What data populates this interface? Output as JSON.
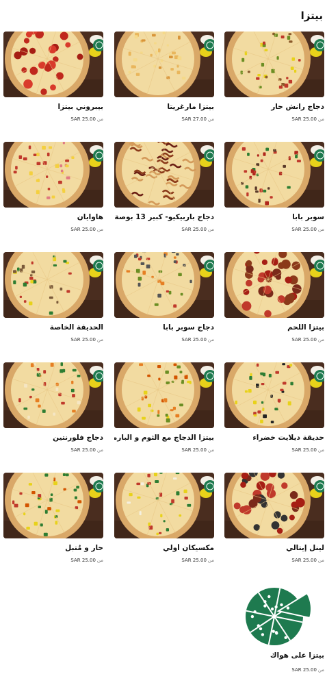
{
  "section": {
    "title": "بيتزا"
  },
  "currency": "SAR",
  "from_label": "من",
  "items": [
    {
      "name": "دجاج رانش حار",
      "price": "25.00",
      "topping": "ranch"
    },
    {
      "name": "بيتزا مارغريتا",
      "price": "27.00",
      "topping": "cheese"
    },
    {
      "name": "بيبروني بيتزا",
      "price": "25.00",
      "topping": "pepperoni"
    },
    {
      "name": "سوبر بابا",
      "price": "25.00",
      "topping": "supreme"
    },
    {
      "name": "دجاج باربيكيو- كبير 13 بوصة",
      "price": "25.00",
      "topping": "bbq"
    },
    {
      "name": "هاوايان",
      "price": "25.00",
      "topping": "hawaiian"
    },
    {
      "name": "بيتزا اللحم",
      "price": "25.00",
      "topping": "meat"
    },
    {
      "name": "دجاج سوبر بابا",
      "price": "25.00",
      "topping": "chicken"
    },
    {
      "name": "الحديقة الخاصة",
      "price": "25.00",
      "topping": "garden"
    },
    {
      "name": "حديقة ديلايت خضراء",
      "price": "25.00",
      "topping": "veggie"
    },
    {
      "name": "بيتزا الدجاج مع الثوم و البارميزان",
      "price": "25.00",
      "topping": "garlic"
    },
    {
      "name": "دجاج فلورنتين",
      "price": "25.00",
      "topping": "florentine"
    },
    {
      "name": "لينل إيتالي",
      "price": "25.00",
      "topping": "italian"
    },
    {
      "name": "مكسيكان أولي",
      "price": "25.00",
      "topping": "mexican"
    },
    {
      "name": "حار و مُتبل",
      "price": "25.00",
      "topping": "spicy"
    }
  ],
  "special": {
    "name": "بيتزا على هواك",
    "price": "25.00",
    "icon": "pizza-slices-icon",
    "color": "#1e7a4f"
  },
  "colors": {
    "crust": "#d9a868",
    "cheese": "#f2dba1",
    "board": "#4a2d1f",
    "badge": "#1e7a4f",
    "pepper": "#e8d21a"
  }
}
